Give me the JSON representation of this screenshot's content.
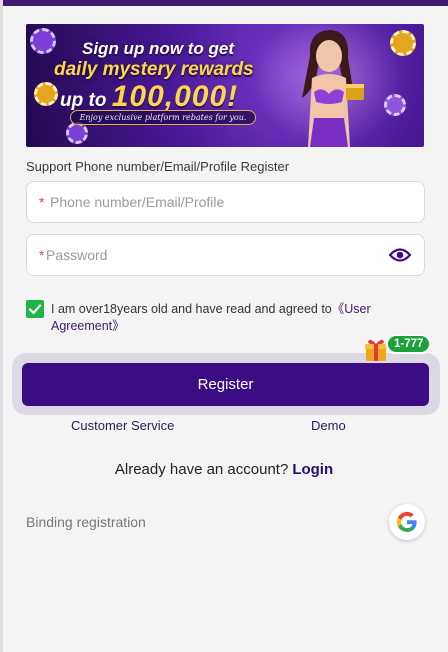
{
  "banner": {
    "line1": "Sign up now to get",
    "line2": "daily mystery rewards",
    "line3_prefix": "up to ",
    "line3_amount": "100,000!",
    "line4": "Enjoy exclusive platform rebates for you."
  },
  "form": {
    "support_label": "Support Phone number/Email/Profile Register",
    "phone_placeholder": "Phone number/Email/Profile",
    "password_placeholder": "Password",
    "required_mark": "*"
  },
  "agreement": {
    "text": "I am over18years old and have read and agreed to",
    "link": "《User Agreement》",
    "checked": true
  },
  "register": {
    "button_label": "Register",
    "promo_badge": "1-777"
  },
  "links": {
    "customer_service": "Customer Service",
    "demo": "Demo"
  },
  "login_prompt": {
    "text": "Already have an account?",
    "link": "Login"
  },
  "binding": {
    "label": "Binding registration"
  },
  "colors": {
    "primary": "#3a0d82",
    "success": "#20b446",
    "required": "#e5484d"
  },
  "icons": [
    "eye-icon",
    "check-icon",
    "gift-icon",
    "google-icon"
  ]
}
